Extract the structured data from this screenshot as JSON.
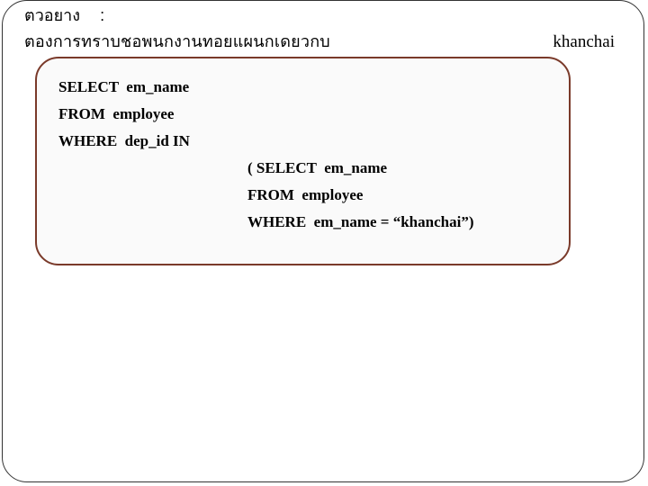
{
  "header": {
    "label": "ตวอยาง",
    "colon": ":",
    "description": "ตองการทราบชอพนกงานทอยแผนกเดยวกบ",
    "right": "khanchai"
  },
  "code": {
    "l1": "SELECT  em_name",
    "l2": "FROM  employee",
    "l3": "WHERE  dep_id IN",
    "sub1": "( SELECT  em_name",
    "sub2": "FROM  employee",
    "sub3": "WHERE  em_name = “khanchai”)"
  }
}
